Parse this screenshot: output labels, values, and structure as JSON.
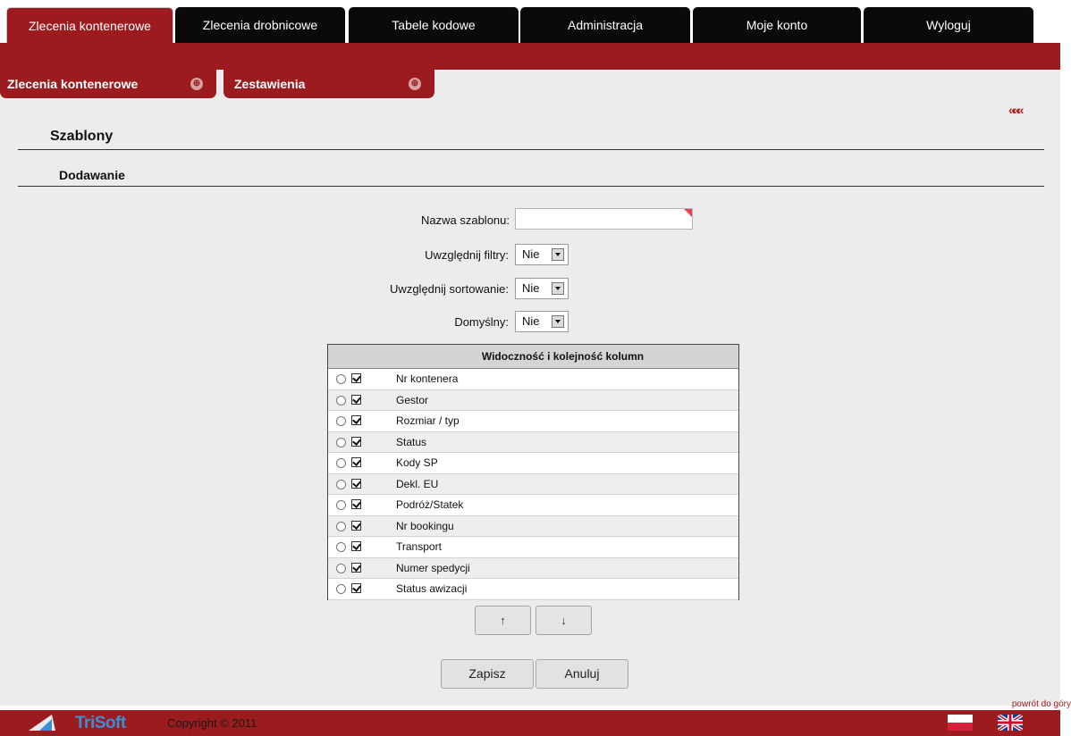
{
  "top_tabs": [
    {
      "label": "Zlecenia kontenerowe",
      "active": true
    },
    {
      "label": "Zlecenia drobnicowe",
      "active": false
    },
    {
      "label": "Tabele kodowe",
      "active": false
    },
    {
      "label": "Administracja",
      "active": false
    },
    {
      "label": "Moje konto",
      "active": false
    },
    {
      "label": "Wyloguj",
      "active": false
    }
  ],
  "sub_tabs": [
    {
      "label": "Zlecenia kontenerowe",
      "icon": "dropdown-icon"
    },
    {
      "label": "Zestawienia",
      "icon": "dropdown-icon"
    }
  ],
  "collapse_icon": "«««",
  "page_title": "Szablony",
  "section_title": "Dodawanie",
  "form": {
    "name_label": "Nazwa szablonu:",
    "name_value": "",
    "filters_label": "Uwzględnij filtry:",
    "filters_value": "Nie",
    "sorting_label": "Uwzględnij sortowanie:",
    "sorting_value": "Nie",
    "default_label": "Domyślny:",
    "default_value": "Nie"
  },
  "columns_table": {
    "header": "Widoczność i kolejność kolumn",
    "rows": [
      {
        "name": "Nr kontenera",
        "selected": false,
        "visible": true
      },
      {
        "name": "Gestor",
        "selected": false,
        "visible": true
      },
      {
        "name": "Rozmiar / typ",
        "selected": false,
        "visible": true
      },
      {
        "name": "Status",
        "selected": false,
        "visible": true
      },
      {
        "name": "Kody SP",
        "selected": false,
        "visible": true
      },
      {
        "name": "Dekl. EU",
        "selected": false,
        "visible": true
      },
      {
        "name": "Podróż/Statek",
        "selected": false,
        "visible": true
      },
      {
        "name": "Nr bookingu",
        "selected": false,
        "visible": true
      },
      {
        "name": "Transport",
        "selected": false,
        "visible": true
      },
      {
        "name": "Numer spedycji",
        "selected": false,
        "visible": true
      },
      {
        "name": "Status awizacji",
        "selected": false,
        "visible": true
      }
    ]
  },
  "move_up_label": "↑",
  "move_down_label": "↓",
  "save_label": "Zapisz",
  "cancel_label": "Anuluj",
  "back_to_top": "powrót do góry",
  "footer": {
    "logo_text": "TriSoft",
    "copyright": "Copyright © 2011"
  },
  "colors": {
    "brand_red": "#9b1b1f",
    "content_bg": "#ececec"
  }
}
